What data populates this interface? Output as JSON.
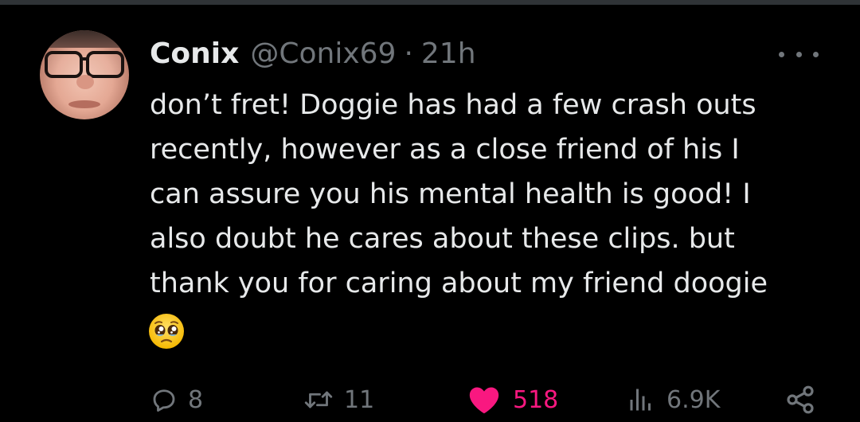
{
  "author": {
    "display_name": "Conix",
    "handle": "@Conix69",
    "separator": "·",
    "time_ago": "21h"
  },
  "tweet": {
    "lines": [
      "don’t fret! Doggie has had a few crash outs",
      "recently, however as a close friend of his I",
      "can assure you his mental health is good! I",
      "also doubt he cares about these clips. but",
      "thank you for caring about my friend doogie"
    ],
    "emoji": "pleading-face-emoji"
  },
  "actions": {
    "replies": "8",
    "retweets": "11",
    "likes": "518",
    "views": "6.9K"
  },
  "colors": {
    "background": "#000000",
    "text_primary": "#e7e9ea",
    "text_secondary": "#71767b",
    "like_active": "#f91880",
    "divider": "#2f3336"
  },
  "icons": {
    "more": "more-horizontal-icon",
    "reply": "reply-icon",
    "retweet": "retweet-icon",
    "like": "heart-filled-icon",
    "views": "views-bar-chart-icon",
    "share": "share-icon"
  }
}
